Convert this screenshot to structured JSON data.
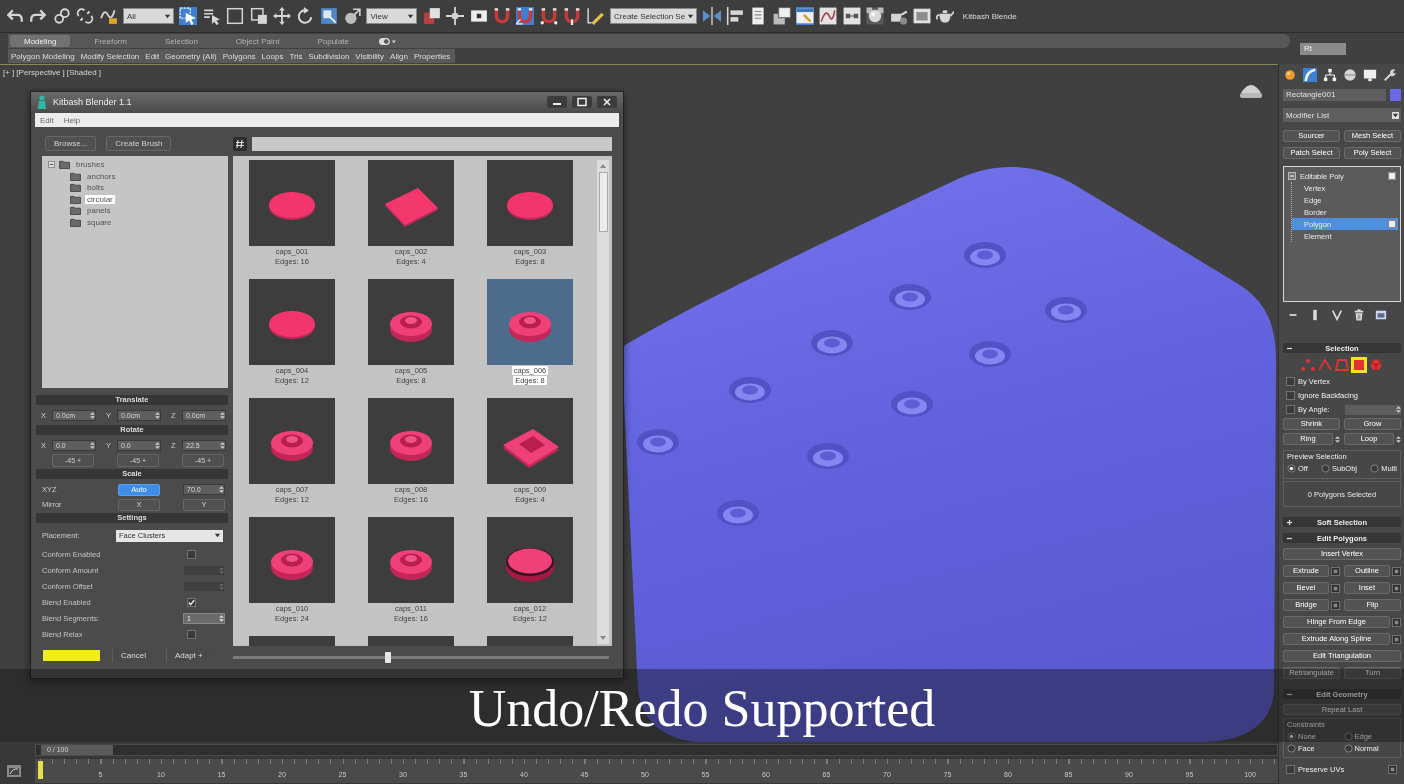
{
  "toolbar": {
    "tools": [
      {
        "kind": "undo",
        "on": false
      },
      {
        "kind": "redo",
        "on": false
      },
      {
        "kind": "chain-link",
        "on": false
      },
      {
        "kind": "broken-chain",
        "on": false
      },
      {
        "kind": "squiggle",
        "on": false
      },
      {
        "kind": "dropdown",
        "value": "All"
      },
      {
        "kind": "arrow-cursor",
        "on": true
      },
      {
        "kind": "list-cursor",
        "on": false
      },
      {
        "kind": "rectangle",
        "on": false
      },
      {
        "kind": "nested-squares",
        "on": false
      },
      {
        "kind": "four-arrows",
        "on": false
      },
      {
        "kind": "circular-arrow",
        "on": false
      },
      {
        "kind": "resize-square",
        "on": false
      },
      {
        "kind": "sphere-arrow",
        "on": false
      },
      {
        "kind": "dropdown",
        "value": "View"
      },
      {
        "kind": "overlapping-squares",
        "on": false
      },
      {
        "kind": "crosshair",
        "on": false
      },
      {
        "kind": "rectangle-dot",
        "on": false
      },
      {
        "kind": "magnet",
        "on": false
      },
      {
        "kind": "angle-magnet",
        "on": true
      },
      {
        "kind": "percent-magnet",
        "on": false
      },
      {
        "kind": "spinner-magnet",
        "on": false
      },
      {
        "kind": "pencil",
        "on": false
      },
      {
        "kind": "dropdown",
        "value": "Create Selection Se"
      },
      {
        "kind": "mirror",
        "on": false
      },
      {
        "kind": "align",
        "on": false
      },
      {
        "kind": "page",
        "on": false
      },
      {
        "kind": "layers",
        "on": false
      },
      {
        "kind": "window",
        "on": true
      },
      {
        "kind": "curve",
        "on": false
      },
      {
        "kind": "connected-boxes",
        "on": false
      },
      {
        "kind": "checkered-sphere",
        "on": false
      },
      {
        "kind": "teapot-gear",
        "on": false
      },
      {
        "kind": "frame-window",
        "on": false
      },
      {
        "kind": "teapot",
        "on": false
      },
      {
        "kind": "label",
        "value": "Kitbash Blende"
      }
    ]
  },
  "ribbon": {
    "tabs": [
      {
        "label": "Modeling",
        "selected": true
      },
      {
        "label": "Freeform",
        "selected": false
      },
      {
        "label": "Selection",
        "selected": false
      },
      {
        "label": "Object Paint",
        "selected": false
      },
      {
        "label": "Populate",
        "selected": false
      }
    ],
    "panels": [
      "Polygon Modeling",
      "Modify Selection",
      "Edit",
      "Geometry (All)",
      "Polygons",
      "Loops",
      "Tris",
      "Subdivision",
      "Visibility",
      "Align",
      "Properties"
    ],
    "field": "Rt"
  },
  "viewport": {
    "labels": [
      "[+ ]",
      "[Perspective ]",
      "[Shaded ]"
    ]
  },
  "dialog": {
    "title": "Kitbash Blender 1.1",
    "menu": [
      "Edit",
      "Help"
    ],
    "buttons": [
      "Browse...",
      "Create Brush"
    ],
    "tree": [
      {
        "label": "brushes",
        "expanded": true,
        "selected": false,
        "children": [
          {
            "label": "anchors",
            "selected": false
          },
          {
            "label": "bolts",
            "selected": false
          },
          {
            "label": "circular",
            "selected": true
          },
          {
            "label": "panels",
            "selected": false
          },
          {
            "label": "square",
            "selected": false
          }
        ]
      }
    ],
    "translate": {
      "title": "Translate",
      "fields": [
        {
          "axis": "X",
          "value": "0.0cm"
        },
        {
          "axis": "Y",
          "value": "0.0cm"
        },
        {
          "axis": "Z",
          "value": "0.0cm"
        }
      ]
    },
    "rotate": {
      "title": "Rotate",
      "fields": [
        {
          "axis": "X",
          "value": "0.0"
        },
        {
          "axis": "Y",
          "value": "0.0"
        },
        {
          "axis": "Z",
          "value": "22.5"
        }
      ],
      "step_buttons": [
        "-45 +",
        "-45 +",
        "-45 +"
      ]
    },
    "scale": {
      "title": "Scale",
      "xyz_label": "XYZ",
      "auto": {
        "label": "Auto",
        "on": true
      },
      "value": "70.0",
      "mirror_label": "Mirror",
      "mirror_buttons": [
        "X",
        "Y"
      ]
    },
    "settings": {
      "title": "Settings",
      "placement_label": "Placement:",
      "placement": "Face Clusters",
      "options": [
        {
          "kind": "checkbox",
          "label": "Conform Enabled",
          "checked": false
        },
        {
          "kind": "spinner",
          "label": "Conform Amount",
          "disabled": true
        },
        {
          "kind": "spinner",
          "label": "Conform Offset",
          "disabled": true
        },
        {
          "kind": "checkbox",
          "label": "Blend Enabled",
          "checked": true
        },
        {
          "kind": "spinner",
          "label": "Blend Segments:",
          "value": "1",
          "disabled": false
        },
        {
          "kind": "checkbox",
          "label": "Blend Relax",
          "checked": false
        }
      ]
    },
    "footer": {
      "cancel": "Cancel",
      "apply": "Adapt +"
    },
    "brushes": [
      {
        "name": "caps_001",
        "edges": "Edges: 16",
        "kind": "disc",
        "selected": false
      },
      {
        "name": "caps_002",
        "edges": "Edges: 4",
        "kind": "square",
        "selected": false
      },
      {
        "name": "caps_003",
        "edges": "Edges: 8",
        "kind": "disc",
        "selected": false
      },
      {
        "name": "caps_004",
        "edges": "Edges: 12",
        "kind": "disc",
        "selected": false
      },
      {
        "name": "caps_005",
        "edges": "Edges: 8",
        "kind": "ring",
        "selected": false
      },
      {
        "name": "caps_006",
        "edges": "Edges: 8",
        "kind": "ring",
        "selected": true
      },
      {
        "name": "caps_007",
        "edges": "Edges: 12",
        "kind": "ring",
        "selected": false
      },
      {
        "name": "caps_008",
        "edges": "Edges: 16",
        "kind": "ring",
        "selected": false
      },
      {
        "name": "caps_009",
        "edges": "Edges: 4",
        "kind": "square-ring",
        "selected": false
      },
      {
        "name": "caps_010",
        "edges": "Edges: 24",
        "kind": "ring",
        "selected": false
      },
      {
        "name": "caps_011",
        "edges": "Edges: 16",
        "kind": "ring",
        "selected": false
      },
      {
        "name": "caps_012",
        "edges": "Edges: 12",
        "kind": "rim",
        "selected": false
      },
      {
        "selected": false
      },
      {
        "selected": false
      },
      {
        "selected": false
      }
    ],
    "zoom_slider": {
      "level": 0.41
    }
  },
  "command_panel": {
    "tabs": [
      {
        "kind": "sphere",
        "selected": false
      },
      {
        "kind": "bent-tube",
        "selected": true
      },
      {
        "kind": "hierarchy",
        "selected": false
      },
      {
        "kind": "striped-circle",
        "selected": false
      },
      {
        "kind": "monitor",
        "selected": false
      },
      {
        "kind": "wrench",
        "selected": false
      }
    ],
    "object_name": "Rectangle001",
    "modifier_list": "Modifier List",
    "modifier_buttons": [
      "Sourcer",
      "Mesh Select",
      "Patch Select",
      "Poly Select"
    ],
    "stack": [
      {
        "label": "Editable Poly",
        "expanded": true,
        "selected": false,
        "children": [
          {
            "label": "Vertex",
            "selected": false
          },
          {
            "label": "Edge",
            "selected": false
          },
          {
            "label": "Border",
            "selected": false
          },
          {
            "label": "Polygon",
            "selected": true
          },
          {
            "label": "Element",
            "selected": false
          }
        ]
      }
    ],
    "selection": {
      "title": "Selection",
      "expanded": true,
      "subobjects": [
        {
          "kind": "vertex",
          "selected": false
        },
        {
          "kind": "edge",
          "selected": false
        },
        {
          "kind": "border",
          "selected": false
        },
        {
          "kind": "polygon",
          "selected": true
        },
        {
          "kind": "element",
          "selected": false
        }
      ],
      "options": [
        {
          "kind": "checkbox",
          "label": "By Vertex",
          "checked": false
        },
        {
          "kind": "checkbox",
          "label": "Ignore Backfacing",
          "checked": false
        },
        {
          "kind": "spinner",
          "label": "By Angle:",
          "checked": false
        }
      ],
      "buttons": [
        "Shrink",
        "Grow"
      ],
      "loop_buttons": [
        "Ring",
        "Loop"
      ],
      "preview": {
        "title": "Preview Selection",
        "options": [
          {
            "label": "Off",
            "selected": true
          },
          {
            "label": "SubObj",
            "selected": false
          },
          {
            "label": "Multi",
            "selected": false
          }
        ]
      },
      "status": "0 Polygons Selected"
    },
    "soft_selection": {
      "title": "Soft Selection",
      "expanded": false
    },
    "edit_polygons": {
      "title": "Edit Polygons",
      "expanded": true,
      "rows": [
        [
          {
            "label": "Insert Vertex",
            "settings": false
          }
        ],
        [
          {
            "label": "Extrude",
            "settings": true
          },
          {
            "label": "Outline",
            "settings": true
          }
        ],
        [
          {
            "label": "Bevel",
            "settings": true
          },
          {
            "label": "Inset",
            "settings": true
          }
        ],
        [
          {
            "label": "Bridge",
            "settings": true
          },
          {
            "label": "Flip",
            "settings": false
          }
        ],
        [
          {
            "label": "Hinge From Edge",
            "settings": true
          }
        ],
        [
          {
            "label": "Extrude Along Spline",
            "settings": true
          }
        ],
        [
          {
            "label": "Edit Triangulation",
            "settings": false
          }
        ],
        [
          {
            "label": "Retriangulate",
            "settings": false
          },
          {
            "label": "Turn",
            "settings": false
          }
        ]
      ]
    },
    "edit_geometry": {
      "title": "Edit Geometry",
      "expanded": true,
      "repeat": "Repeat Last",
      "constraints": {
        "title": "Constraints",
        "options": [
          {
            "label": "None",
            "selected": true
          },
          {
            "label": "Edge",
            "selected": false
          },
          {
            "label": "Face",
            "selected": false
          },
          {
            "label": "Normal",
            "selected": false
          }
        ]
      },
      "preserve_uvs": {
        "label": "Preserve UVs",
        "checked": false
      }
    }
  },
  "caption": "Undo/Redo Supported",
  "timeline": {
    "time_slider": {
      "label": "0 / 100",
      "level": 0
    },
    "ruler": [
      "5",
      "10",
      "15",
      "20",
      "25",
      "30",
      "35",
      "40",
      "45",
      "50",
      "55",
      "60",
      "65",
      "70",
      "75",
      "80",
      "85",
      "90",
      "95",
      "100"
    ]
  }
}
